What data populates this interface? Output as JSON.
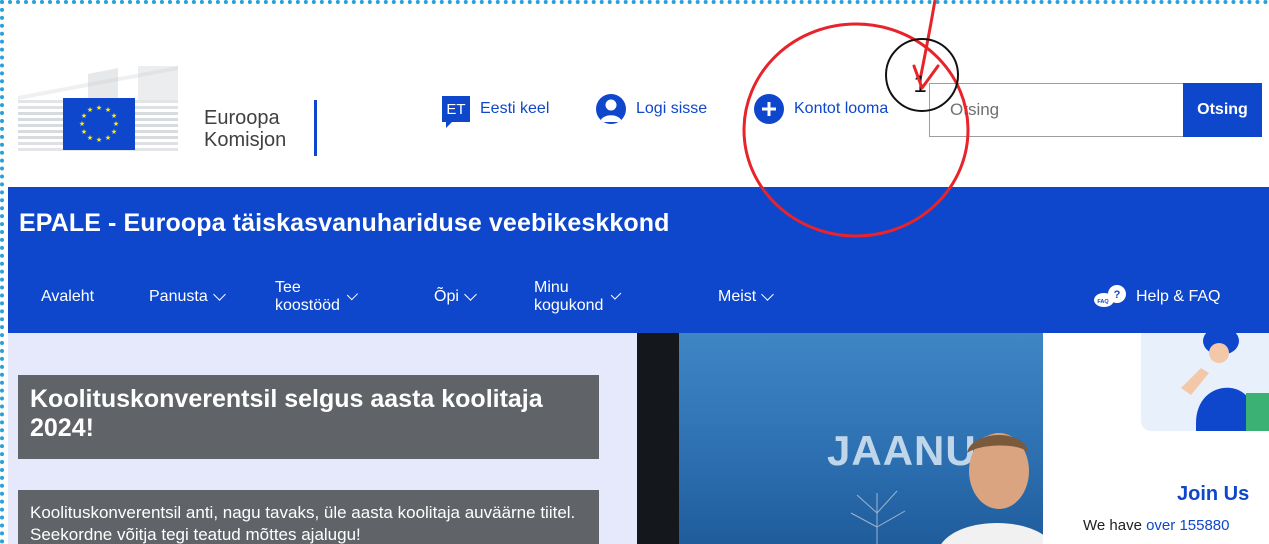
{
  "header": {
    "logo_line1": "Euroopa",
    "logo_line2": "Komisjon",
    "lang_code": "ET",
    "lang_label": "Eesti keel",
    "login_label": "Logi sisse",
    "create_account_label": "Kontot looma",
    "search_placeholder": "Otsing",
    "search_button": "Otsing"
  },
  "band": {
    "site_title": "EPALE - Euroopa täiskasvanuhariduse veebikeskkond",
    "nav": [
      {
        "label": "Avaleht",
        "has_dropdown": false
      },
      {
        "label": "Panusta",
        "has_dropdown": true
      },
      {
        "label": "Tee koostööd",
        "has_dropdown": true
      },
      {
        "label": "Õpi",
        "has_dropdown": true
      },
      {
        "label": "Minu kogukond",
        "has_dropdown": true
      },
      {
        "label": "Meist",
        "has_dropdown": true
      }
    ],
    "help_label": "Help & FAQ",
    "faq_badge": "FAQ"
  },
  "feature": {
    "title": "Koolituskonverentsil selgus aasta koolitaja 2024!",
    "text": "Koolituskonverentsil anti, nagu tavaks, üle aasta koolitaja auväärne tiitel. Seekordne võitja tegi teatud mõttes ajalugu!",
    "photo_word": "JAANUS"
  },
  "join": {
    "title": "Join Us",
    "text_prefix": "We have ",
    "text_link": "over 155880"
  },
  "annotation": {
    "step_number": "1",
    "color": "#e8232a"
  },
  "colors": {
    "brand_blue": "#0e47cb",
    "card_grey": "#606367",
    "panel_lavender": "#e6e8fb"
  }
}
